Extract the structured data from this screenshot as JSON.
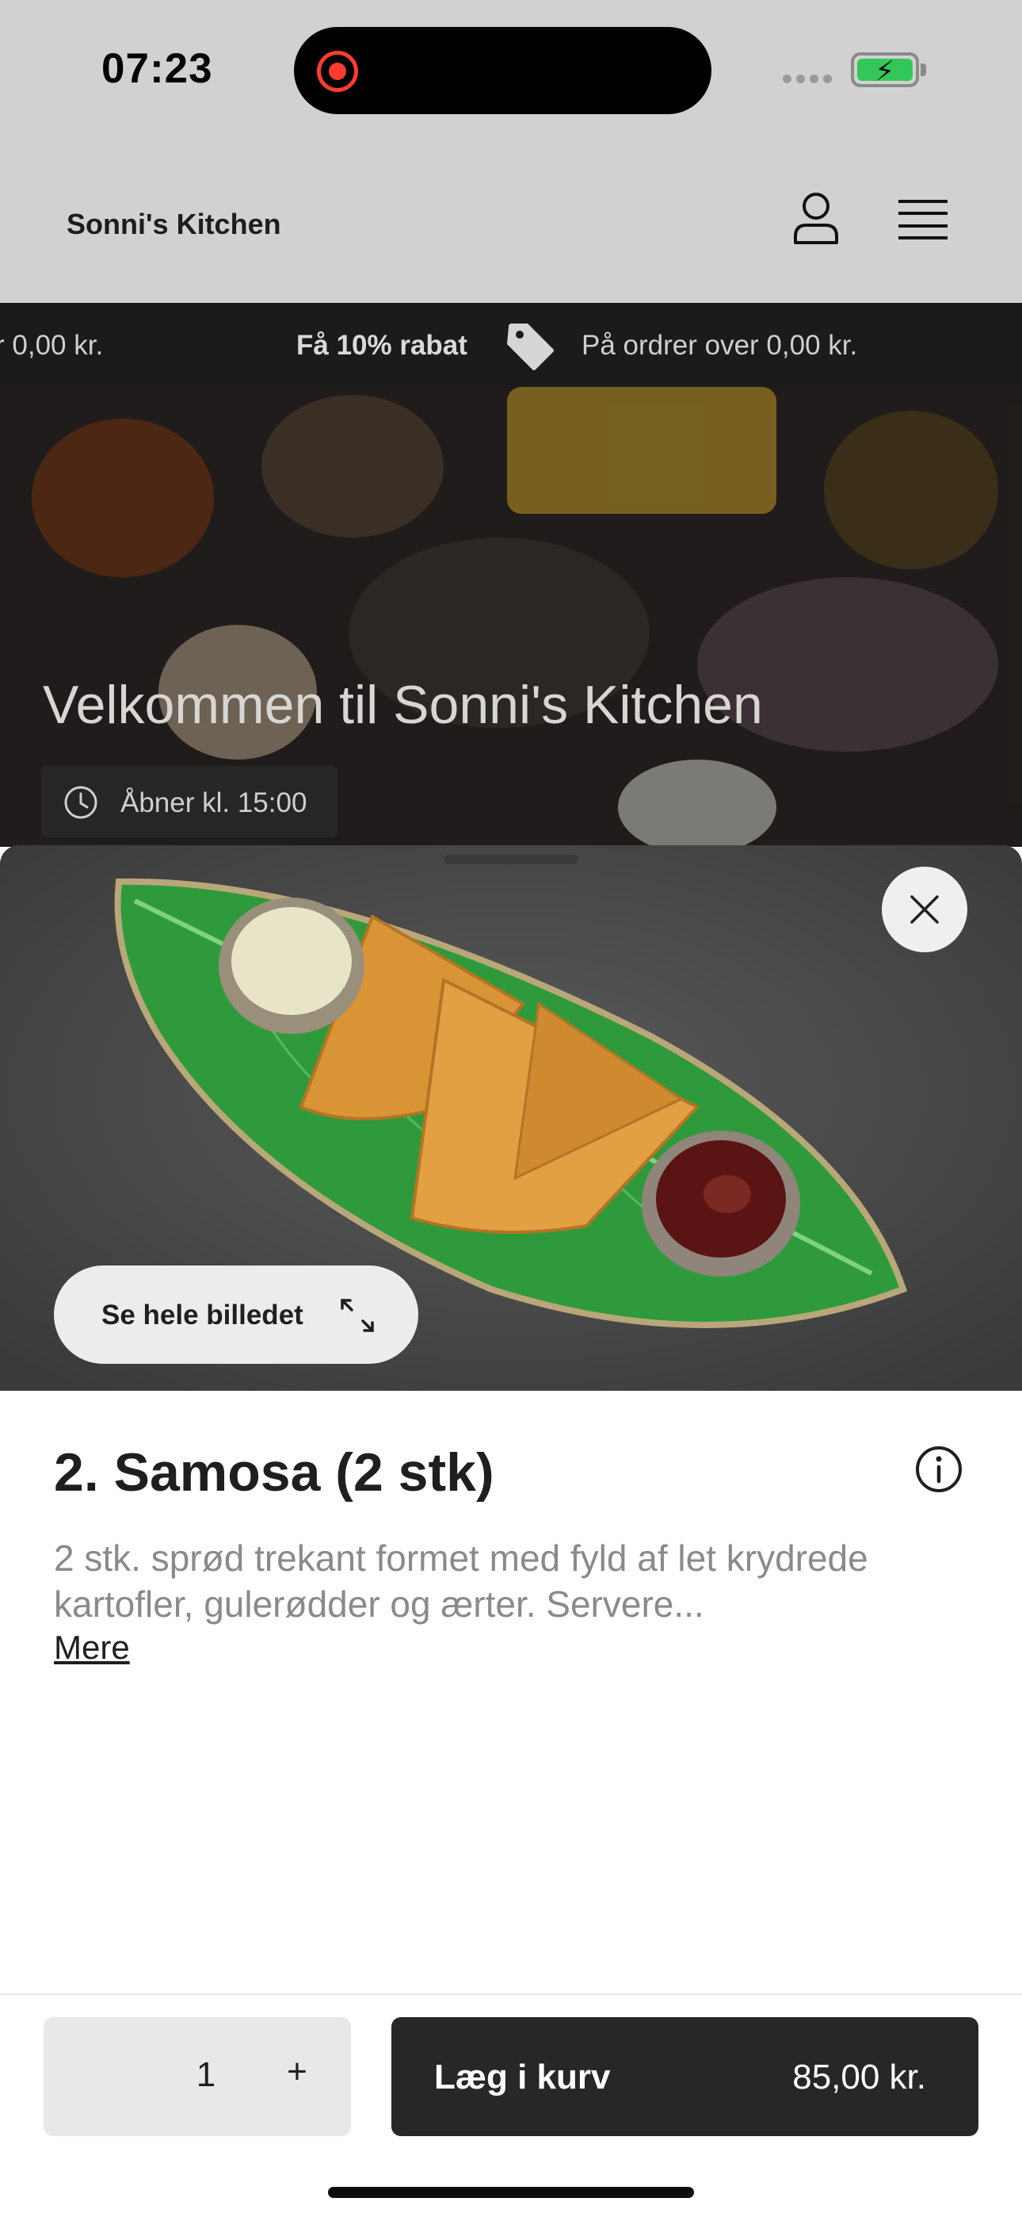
{
  "status_bar": {
    "time": "07:23"
  },
  "header": {
    "brand": "Sonni's Kitchen",
    "icons": [
      "user-icon",
      "menu-icon"
    ]
  },
  "promo": {
    "left_text": "r 0,00 kr.",
    "bold_text": "Få 10% rabat",
    "right_text": "På ordrer over 0,00 kr.",
    "icon": "tag-icon"
  },
  "hero": {
    "title": "Velkommen til Sonni's Kitchen",
    "hours": "Åbner kl. 15:00",
    "icon": "clock-icon"
  },
  "sheet": {
    "see_full_image": "Se hele billedet",
    "product_title": "2. Samosa (2 stk)",
    "description": "2 stk. sprød trekant formet med fyld af let krydrede kartofler, gulerødder og ærter. Servere...",
    "more": "Mere",
    "quantity": "1",
    "plus": "+",
    "add_to_cart": "Læg i kurv",
    "price": "85,00 kr."
  },
  "colors": {
    "dark_button": "#272727",
    "page_dim": "#d1d1d1",
    "promo_bar": "#1b1b1b",
    "leaf_green": "#2f9a3c",
    "battery_green": "#33c759",
    "record_red": "#ff3b30"
  }
}
